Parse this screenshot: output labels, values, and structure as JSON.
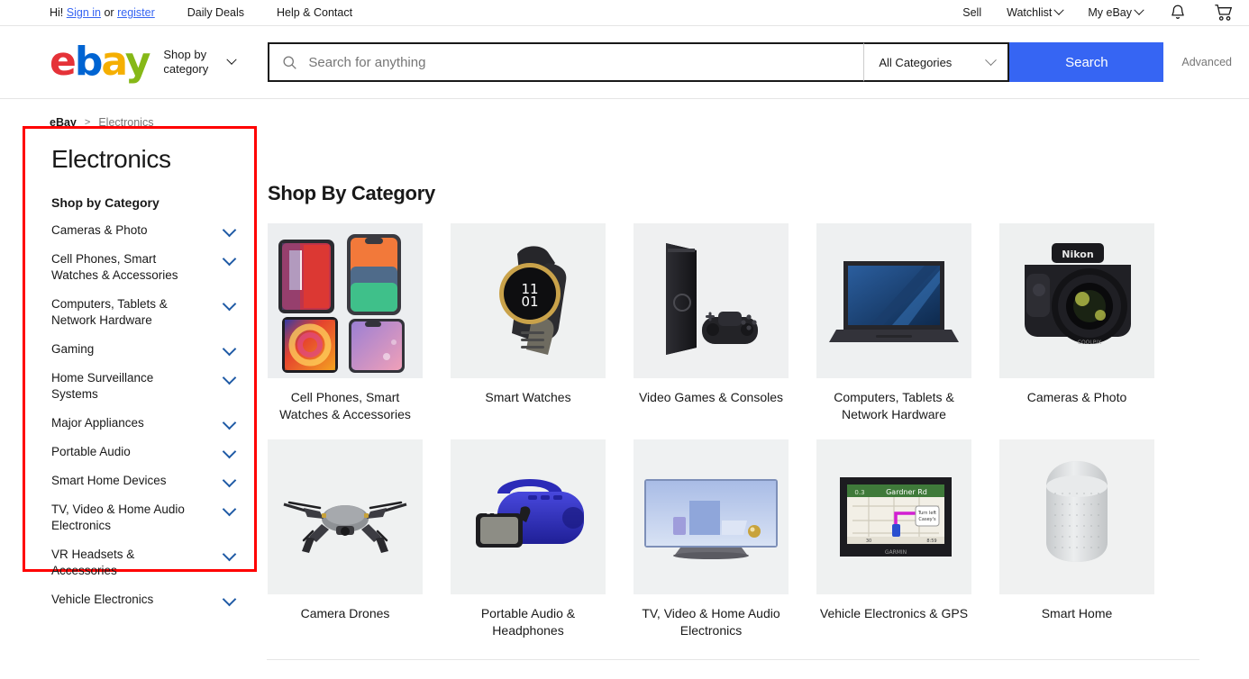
{
  "topbar": {
    "greeting_prefix": "Hi!",
    "signin": "Sign in",
    "or": "or",
    "register": "register",
    "daily_deals": "Daily Deals",
    "help_contact": "Help & Contact",
    "sell": "Sell",
    "watchlist": "Watchlist",
    "my_ebay": "My eBay",
    "bell_icon": "notification-bell-icon",
    "cart_icon": "shopping-cart-icon"
  },
  "header": {
    "logo": {
      "e": "e",
      "b": "b",
      "a": "a",
      "y": "y"
    },
    "shop_by_category": "Shop by category",
    "search_placeholder": "Search for anything",
    "search_value": "",
    "category_selected": "All Categories",
    "search_button": "Search",
    "advanced": "Advanced"
  },
  "breadcrumb": {
    "home": "eBay",
    "separator": ">",
    "current": "Electronics"
  },
  "sidebar": {
    "title": "Electronics",
    "subtitle": "Shop by Category",
    "highlight_color": "#ff0000",
    "chevron_color": "#1f5aa5",
    "items": [
      {
        "label": "Cameras & Photo"
      },
      {
        "label": "Cell Phones, Smart Watches & Accessories"
      },
      {
        "label": "Computers, Tablets & Network Hardware"
      },
      {
        "label": "Gaming"
      },
      {
        "label": "Home Surveillance Systems"
      },
      {
        "label": "Major Appliances"
      },
      {
        "label": "Portable Audio"
      },
      {
        "label": "Smart Home Devices"
      },
      {
        "label": "TV, Video & Home Audio Electronics"
      },
      {
        "label": "VR Headsets & Accessories"
      },
      {
        "label": "Vehicle Electronics"
      }
    ]
  },
  "main": {
    "heading": "Shop By Category",
    "tiles": [
      {
        "label": "Cell Phones, Smart Watches & Accessories",
        "art": "phones"
      },
      {
        "label": "Smart Watches",
        "art": "watch"
      },
      {
        "label": "Video Games & Consoles",
        "art": "console"
      },
      {
        "label": "Computers, Tablets & Network Hardware",
        "art": "laptop"
      },
      {
        "label": "Cameras & Photo",
        "art": "camera"
      },
      {
        "label": "Camera Drones",
        "art": "drone"
      },
      {
        "label": "Portable Audio & Headphones",
        "art": "speaker"
      },
      {
        "label": "TV, Video & Home Audio Electronics",
        "art": "tv"
      },
      {
        "label": "Vehicle Electronics & GPS",
        "art": "gps"
      },
      {
        "label": "Smart Home",
        "art": "homepod"
      }
    ]
  }
}
